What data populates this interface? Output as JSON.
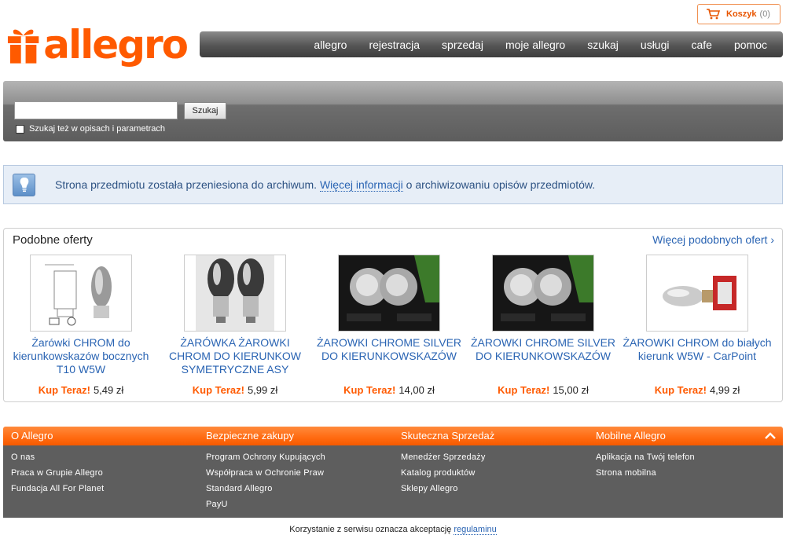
{
  "brand": {
    "logo_text": "allegro",
    "accent": "#ff5a00",
    "link": "#2a64b3"
  },
  "cart": {
    "label": "Koszyk",
    "count": "(0)",
    "icon": "cart-icon"
  },
  "nav": [
    "allegro",
    "rejestracja",
    "sprzedaj",
    "moje allegro",
    "szukaj",
    "usługi",
    "cafe",
    "pomoc"
  ],
  "search": {
    "value": "",
    "button": "Szukaj",
    "checkbox_label": "Szukaj też w opisach i parametrach",
    "checkbox_checked": false
  },
  "info": {
    "icon": "lightbulb-icon",
    "text_before": "Strona przedmiotu została przeniesiona do archiwum. ",
    "link": "Więcej informacji",
    "text_after": " o archiwizowaniu opisów przedmiotów."
  },
  "similar": {
    "title": "Podobne oferty",
    "more": "Więcej podobnych ofert ›",
    "offers": [
      {
        "title": "Żarówki CHROM do kierunkowskazów bocznych T10 W5W",
        "buy_label": "Kup Teraz!",
        "price": "5,49 zł"
      },
      {
        "title": "ŻARÓWKA ŻAROWKI CHROM DO KIERUNKOW SYMETRYCZNE ASY",
        "buy_label": "Kup Teraz!",
        "price": "5,99 zł"
      },
      {
        "title": "ŻAROWKI CHROME SILVER DO KIERUNKOWSKAZÓW",
        "buy_label": "Kup Teraz!",
        "price": "14,00 zł"
      },
      {
        "title": "ŻAROWKI CHROME SILVER DO KIERUNKOWSKAZÓW",
        "buy_label": "Kup Teraz!",
        "price": "15,00 zł"
      },
      {
        "title": "ŻAROWKI CHROM do białych kierunk W5W - CarPoint",
        "buy_label": "Kup Teraz!",
        "price": "4,99 zł"
      }
    ]
  },
  "footer": {
    "columns": [
      {
        "heading": "O Allegro",
        "links": [
          "O nas",
          "Praca w Grupie Allegro",
          "Fundacja All For Planet"
        ]
      },
      {
        "heading": "Bezpieczne zakupy",
        "links": [
          "Program Ochrony Kupujących",
          "Współpraca w Ochronie Praw",
          "Standard Allegro",
          "PayU"
        ]
      },
      {
        "heading": "Skuteczna Sprzedaż",
        "links": [
          "Menedżer Sprzedaży",
          "Katalog produktów",
          "Sklepy Allegro"
        ]
      },
      {
        "heading": "Mobilne Allegro",
        "links": [
          "Aplikacja na Twój telefon",
          "Strona mobilna"
        ]
      }
    ],
    "legal_text": "Korzystanie z serwisu oznacza akceptację ",
    "legal_link": "regulaminu"
  }
}
